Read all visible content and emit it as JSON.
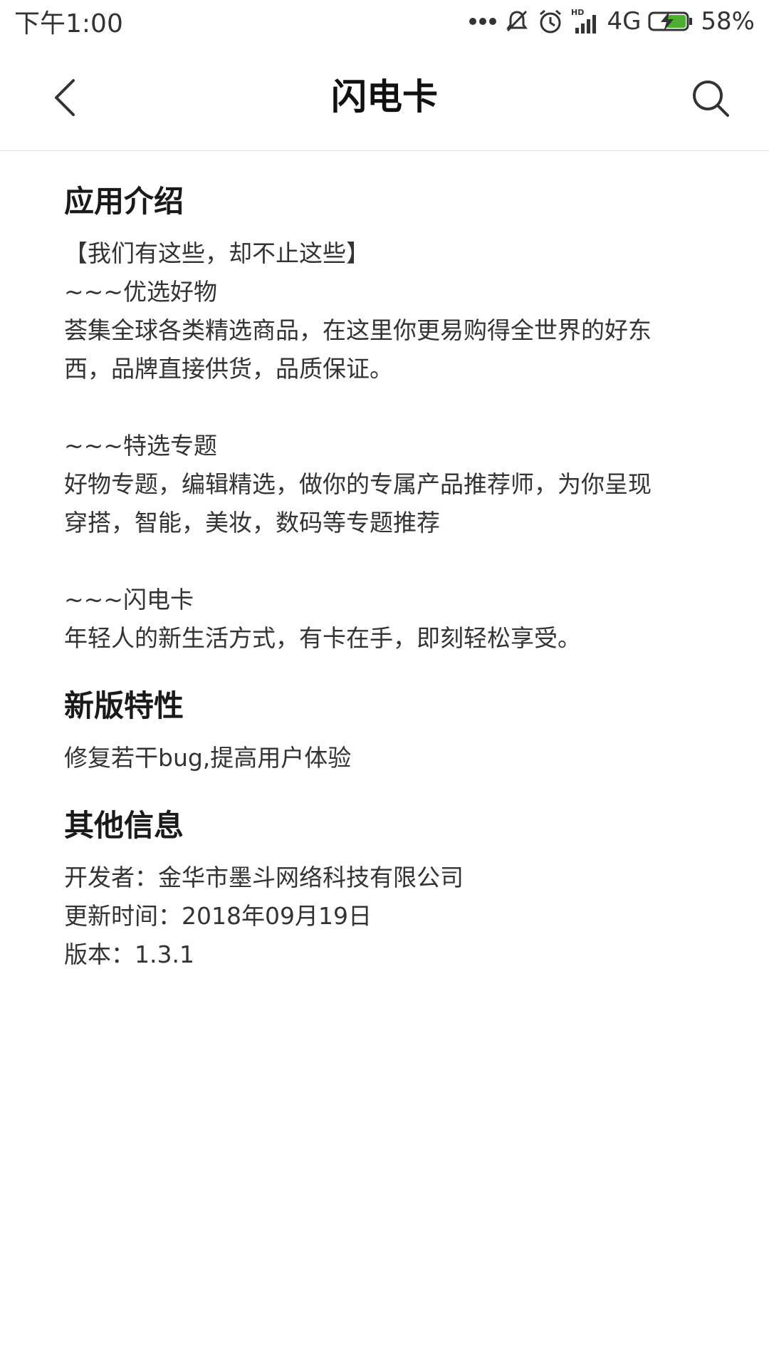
{
  "status_bar": {
    "time": "下午1:00",
    "network": "4G",
    "battery": "58%",
    "icons": [
      "more-dots-icon",
      "mute-icon",
      "alarm-icon",
      "hd-signal-icon",
      "battery-charging-icon"
    ]
  },
  "nav": {
    "title": "闪电卡",
    "back_icon": "chevron-left-icon",
    "search_icon": "search-icon"
  },
  "sections": {
    "intro": {
      "title": "应用介绍",
      "lines": [
        "【我们有这些，却不止这些】",
        "~~~优选好物",
        "荟集全球各类精选商品，在这里你更易购得全世界的好东",
        "西，品牌直接供货，品质保证。",
        "~~~特选专题",
        "好物专题，编辑精选，做你的专属产品推荐师，为你呈现",
        "穿搭，智能，美妆，数码等专题推荐",
        "~~~闪电卡",
        "年轻人的新生活方式，有卡在手，即刻轻松享受。"
      ]
    },
    "whats_new": {
      "title": "新版特性",
      "text": "修复若干bug,提高用户体验"
    },
    "other": {
      "title": "其他信息",
      "developer": "开发者：金华市墨斗网络科技有限公司",
      "updated": "更新时间：2018年09月19日",
      "version": "版本：1.3.1"
    }
  }
}
